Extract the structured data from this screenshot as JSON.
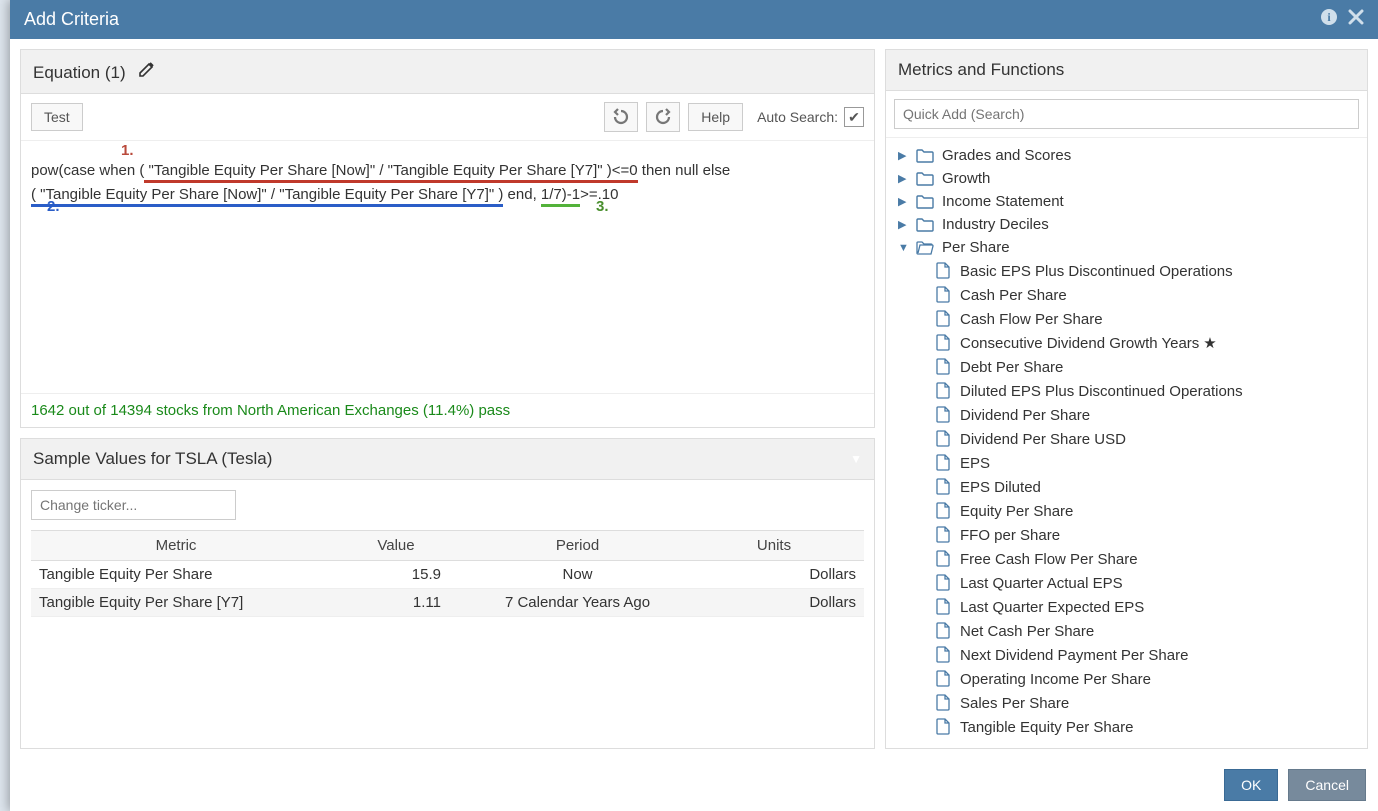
{
  "dialog": {
    "title": "Add Criteria"
  },
  "equation": {
    "header": "Equation (1)",
    "test_label": "Test",
    "help_label": "Help",
    "auto_search_label": "Auto Search:",
    "line1a": "pow(case when (",
    "line1b_quoted": " \"Tangible Equity Per Share [Now]\" / \"Tangible Equity Per Share [Y7]\" )<=0",
    "line1c": " then null else",
    "line2a_quoted": "( \"Tangible Equity Per Share [Now]\" / \"Tangible Equity Per Share [Y7]\" )",
    "line2b": " end, ",
    "line2c_green": "1/7)-1",
    "line2d": ">=.10",
    "label1": "1.",
    "label2": "2.",
    "label3": "3.",
    "result": "1642 out of 14394 stocks from North American Exchanges (11.4%) pass"
  },
  "sample": {
    "header": "Sample Values for TSLA (Tesla)",
    "ticker_placeholder": "Change ticker...",
    "columns": {
      "metric": "Metric",
      "value": "Value",
      "period": "Period",
      "units": "Units"
    },
    "rows": [
      {
        "metric": "Tangible Equity Per Share",
        "value": "15.9",
        "period": "Now",
        "units": "Dollars"
      },
      {
        "metric": "Tangible Equity Per Share [Y7]",
        "value": "1.11",
        "period": "7 Calendar Years Ago",
        "units": "Dollars"
      }
    ]
  },
  "metrics": {
    "header": "Metrics and Functions",
    "search_placeholder": "Quick Add (Search)",
    "folders": [
      {
        "label": "Grades and Scores",
        "open": false
      },
      {
        "label": "Growth",
        "open": false
      },
      {
        "label": "Income Statement",
        "open": false
      },
      {
        "label": "Industry Deciles",
        "open": false
      }
    ],
    "open_folder": {
      "label": "Per Share"
    },
    "files": [
      {
        "label": "Basic EPS Plus Discontinued Operations"
      },
      {
        "label": "Cash Per Share"
      },
      {
        "label": "Cash Flow Per Share"
      },
      {
        "label": "Consecutive Dividend Growth Years",
        "star": true
      },
      {
        "label": "Debt Per Share"
      },
      {
        "label": "Diluted EPS Plus Discontinued Operations"
      },
      {
        "label": "Dividend Per Share"
      },
      {
        "label": "Dividend Per Share USD"
      },
      {
        "label": "EPS"
      },
      {
        "label": "EPS Diluted"
      },
      {
        "label": "Equity Per Share"
      },
      {
        "label": "FFO per Share"
      },
      {
        "label": "Free Cash Flow Per Share"
      },
      {
        "label": "Last Quarter Actual EPS"
      },
      {
        "label": "Last Quarter Expected EPS"
      },
      {
        "label": "Net Cash Per Share"
      },
      {
        "label": "Next Dividend Payment Per Share"
      },
      {
        "label": "Operating Income Per Share"
      },
      {
        "label": "Sales Per Share"
      },
      {
        "label": "Tangible Equity Per Share"
      }
    ]
  },
  "footer": {
    "ok": "OK",
    "cancel": "Cancel"
  }
}
